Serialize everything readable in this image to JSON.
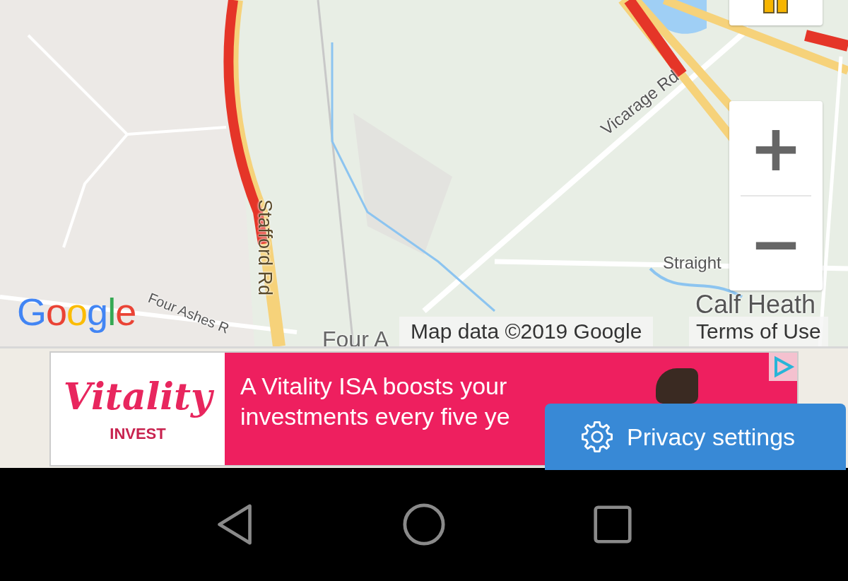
{
  "map": {
    "labels": [
      {
        "text": "Vicarage Rd",
        "kind": "road-diagonal"
      },
      {
        "text": "Stafford Rd",
        "kind": "road-vertical"
      },
      {
        "text": "Straight",
        "kind": "road"
      },
      {
        "text": "Four Ashes R",
        "kind": "road-slant"
      },
      {
        "text": "Four A",
        "kind": "place"
      },
      {
        "text": "Calf Heath",
        "kind": "place-large"
      }
    ],
    "logo": "Google",
    "attribution": "Map data ©2019 Google",
    "terms": "Terms of Use",
    "zoom_in": "+",
    "zoom_out": "−"
  },
  "ad": {
    "brand": "Vitality",
    "brand_sub": "INVEST",
    "lines": [
      "A Vitality ISA boosts your",
      "investments every five ye"
    ]
  },
  "privacy_button": "Privacy settings"
}
